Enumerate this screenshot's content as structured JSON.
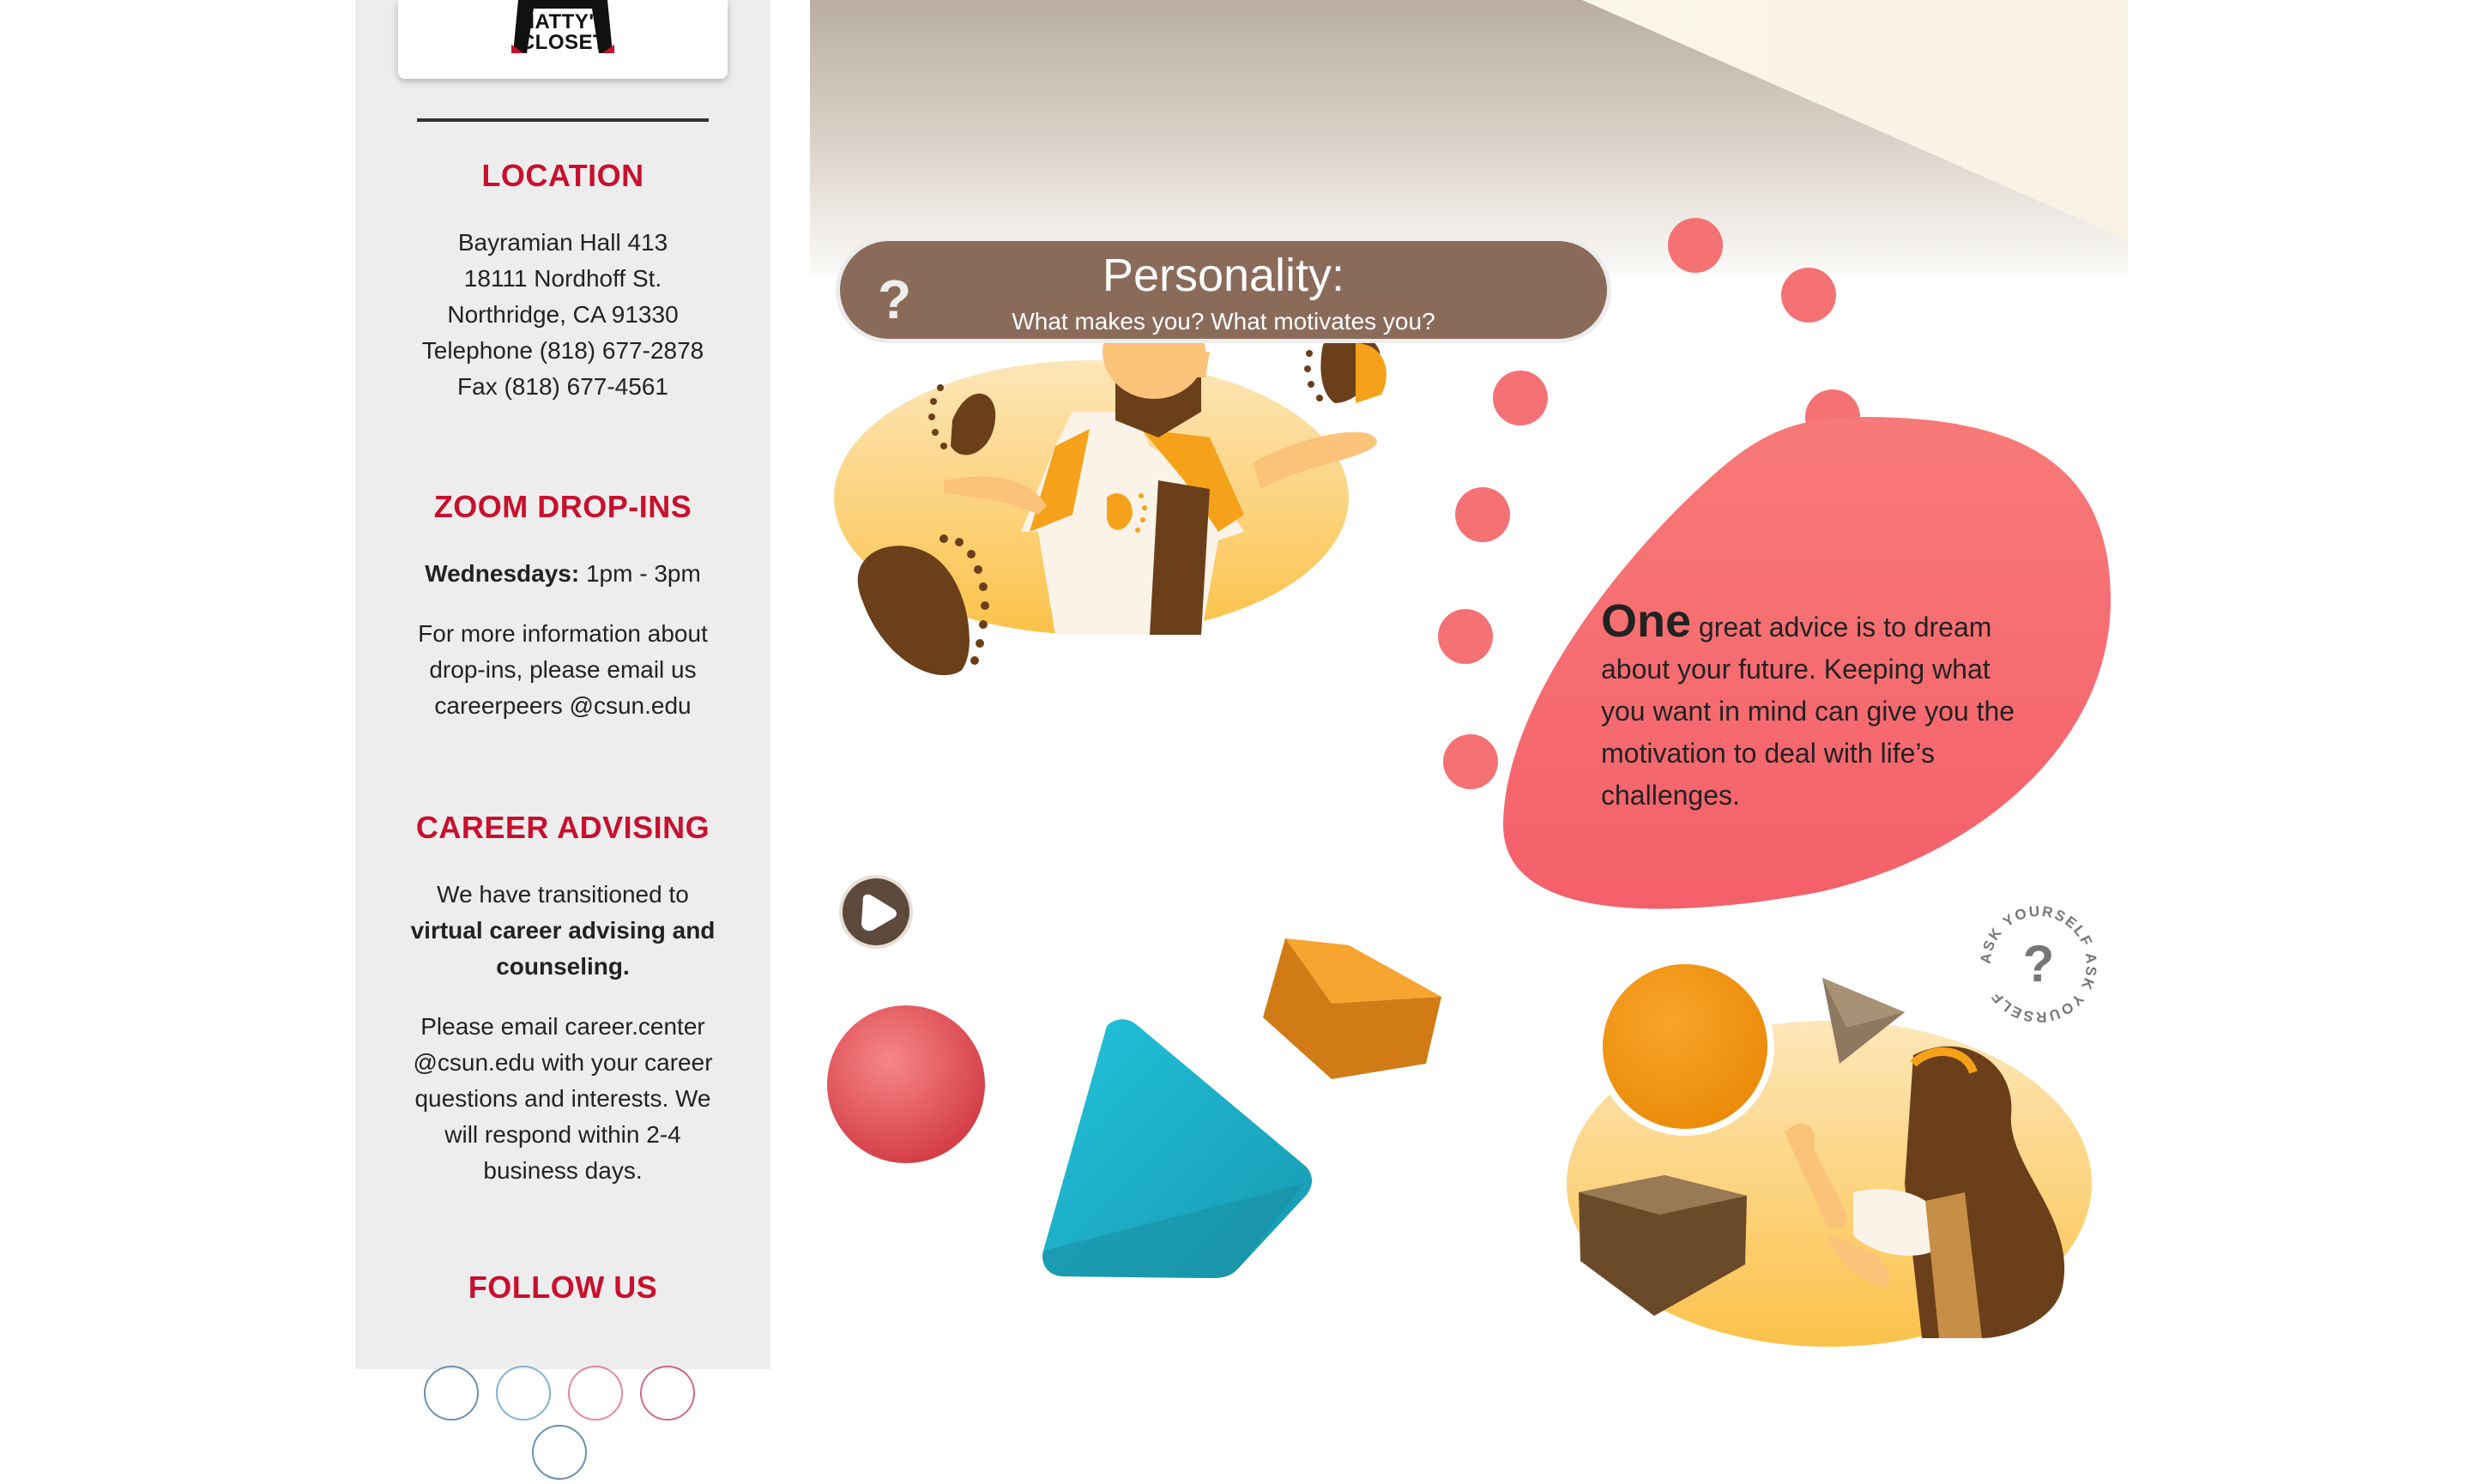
{
  "sidebar": {
    "logo_text": "MATTY'S\nCLOSET",
    "location": {
      "title": "LOCATION",
      "lines": [
        "Bayramian Hall 413",
        "18111 Nordhoff St.",
        "Northridge, CA 91330",
        "Telephone (818) 677-2878",
        "Fax (818) 677-4561"
      ]
    },
    "zoom": {
      "title": "ZOOM DROP-INS",
      "day_label": "Wednesdays:",
      "hours": " 1pm - 3pm",
      "info_lines": [
        "For more information about",
        "drop-ins, please email us",
        "careerpeers @csun.edu"
      ]
    },
    "advising": {
      "title": "CAREER ADVISING",
      "line1": "We have transitioned to",
      "bold_lines": [
        "virtual career advising and",
        "counseling."
      ],
      "info_lines": [
        "Please email career.center",
        "@csun.edu with your career",
        "questions and interests. We",
        "will respond within 2-4",
        "business days."
      ]
    },
    "follow": {
      "title": "FOLLOW US"
    }
  },
  "main": {
    "banner": {
      "icon": "question-mark-icon",
      "title": "Personality:",
      "subtitle": "What makes you? What motivates you?"
    },
    "bubble": {
      "lead": "One",
      "first_line": " great advice is to dream",
      "lines": [
        "about your future. Keeping what",
        "you want in mind can give you the",
        "motivation to deal with life’s",
        "challenges."
      ]
    },
    "play_button": {
      "icon": "play-icon"
    },
    "badge": {
      "text": "ASK YOURSELF ASK YOURSELF ",
      "icon": "question-mark-icon"
    }
  },
  "colors": {
    "accent_red": "#c8102e",
    "sidebar_bg": "#ededed",
    "banner_bg": "#8a6b5a",
    "bubble": "#f56b6b",
    "orange": "#f5a21a",
    "teal": "#1cb6cf",
    "brown": "#6b3f1a"
  }
}
